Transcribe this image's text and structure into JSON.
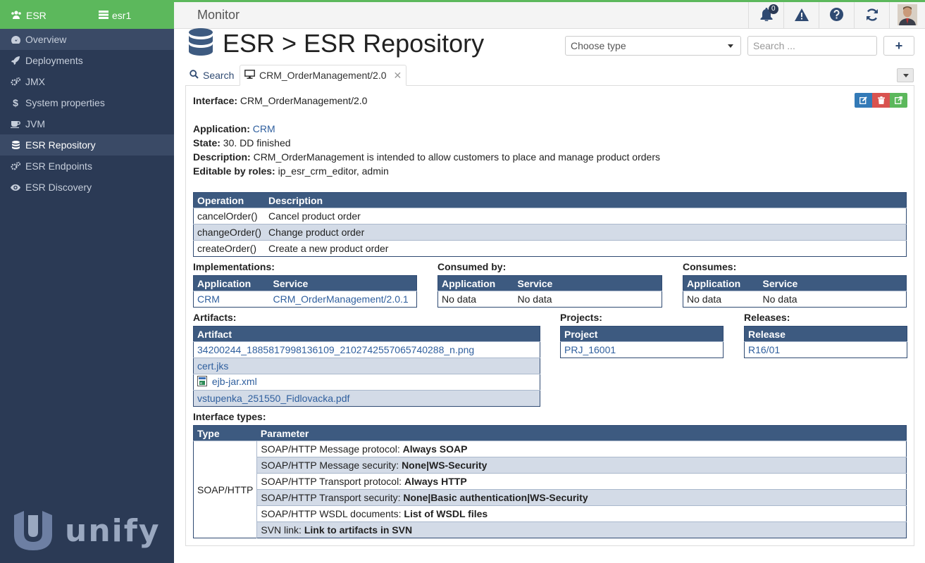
{
  "sidebar": {
    "app_name": "ESR",
    "server_name": "esr1",
    "items": [
      {
        "label": "Overview",
        "icon": "dashboard-icon"
      },
      {
        "label": "Deployments",
        "icon": "rocket-icon"
      },
      {
        "label": "JMX",
        "icon": "gears-icon"
      },
      {
        "label": "System properties",
        "icon": "dollar-icon"
      },
      {
        "label": "JVM",
        "icon": "coffee-icon"
      },
      {
        "label": "ESR Repository",
        "icon": "database-icon"
      },
      {
        "label": "ESR Endpoints",
        "icon": "gears-icon"
      },
      {
        "label": "ESR Discovery",
        "icon": "eye-icon"
      }
    ],
    "logo_text": "unify"
  },
  "topbar": {
    "title": "Monitor",
    "notifications_count": "0"
  },
  "page": {
    "heading": "ESR > ESR Repository",
    "type_select": "Choose type",
    "search_placeholder": "Search ...",
    "add_label": "+"
  },
  "tabs": {
    "search": "Search",
    "current": "CRM_OrderManagement/2.0"
  },
  "detail": {
    "interface_label": "Interface:",
    "interface_value": "CRM_OrderManagement/2.0",
    "application_label": "Application:",
    "application_value": "CRM",
    "state_label": "State:",
    "state_value": "30. DD finished",
    "description_label": "Description:",
    "description_value": "CRM_OrderManagement is intended to allow customers to place and manage product orders",
    "roles_label": "Editable by roles:",
    "roles_value": "ip_esr_crm_editor, admin"
  },
  "operations": {
    "headers": [
      "Operation",
      "Description"
    ],
    "rows": [
      [
        "cancelOrder()",
        "Cancel product order"
      ],
      [
        "changeOrder()",
        "Change product order"
      ],
      [
        "createOrder()",
        "Create a new product order"
      ]
    ]
  },
  "implementations": {
    "label": "Implementations:",
    "headers": [
      "Application",
      "Service"
    ],
    "rows": [
      [
        "CRM",
        "CRM_OrderManagement/2.0.1"
      ]
    ]
  },
  "consumed_by": {
    "label": "Consumed by:",
    "headers": [
      "Application",
      "Service"
    ],
    "rows": [
      [
        "No data",
        "No data"
      ]
    ]
  },
  "consumes": {
    "label": "Consumes:",
    "headers": [
      "Application",
      "Service"
    ],
    "rows": [
      [
        "No data",
        "No data"
      ]
    ]
  },
  "artifacts": {
    "label": "Artifacts:",
    "header": "Artifact",
    "rows": [
      "34200244_1885817998136109_2102742557065740288_n.png",
      "cert.jks",
      "ejb-jar.xml",
      "vstupenka_251550_Fidlovacka.pdf"
    ]
  },
  "projects": {
    "label": "Projects:",
    "header": "Project",
    "rows": [
      "PRJ_16001"
    ]
  },
  "releases": {
    "label": "Releases:",
    "header": "Release",
    "rows": [
      "R16/01"
    ]
  },
  "interface_types": {
    "label": "Interface types:",
    "headers": [
      "Type",
      "Parameter"
    ],
    "type": "SOAP/HTTP",
    "params": [
      {
        "name": "SOAP/HTTP Message protocol:",
        "value": "Always SOAP"
      },
      {
        "name": "SOAP/HTTP Message security:",
        "value": "None|WS-Security"
      },
      {
        "name": "SOAP/HTTP Transport protocol:",
        "value": "Always HTTP"
      },
      {
        "name": "SOAP/HTTP Transport security:",
        "value": "None|Basic authentication|WS-Security"
      },
      {
        "name": "SOAP/HTTP WSDL documents:",
        "value": "List of WSDL files"
      },
      {
        "name": "SVN link:",
        "value": "Link to artifacts in SVN"
      }
    ]
  },
  "colors": {
    "accent_green": "#5cb85c",
    "sidebar_bg": "#2b3a55",
    "table_header": "#3d5a80",
    "edit_btn": "#337ab7",
    "delete_btn": "#d9534f",
    "open_btn": "#5cb85c"
  }
}
